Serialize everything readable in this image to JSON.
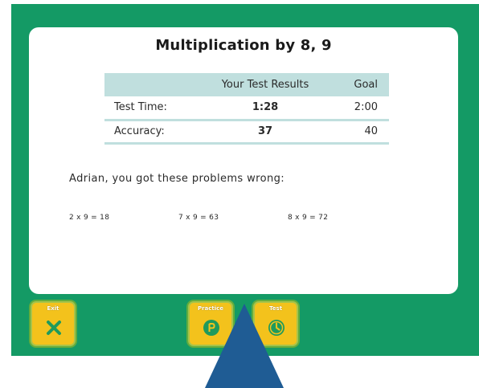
{
  "title": "Multiplication by 8, 9",
  "results_table": {
    "headers": [
      "",
      "Your Test Results",
      "Goal"
    ],
    "rows": [
      {
        "label": "Test Time:",
        "result": "1:28",
        "goal": "2:00"
      },
      {
        "label": "Accuracy:",
        "result": "37",
        "goal": "40"
      }
    ]
  },
  "wrong_message": "Adrian, you got these problems wrong:",
  "wrong_problems": [
    "2 x 9 = 18",
    "7 x 9 = 63",
    "8 x 9 = 72"
  ],
  "buttons": {
    "exit": {
      "label": "Exit",
      "icon": "close-x-icon"
    },
    "practice": {
      "label": "Practice",
      "icon": "p-circle-icon"
    },
    "test": {
      "label": "Test",
      "icon": "clock-icon"
    }
  },
  "colors": {
    "background_green": "#149a65",
    "table_accent": "#c0dfde",
    "button_yellow": "#f3c21c",
    "pointer_blue": "#1f5c94"
  }
}
